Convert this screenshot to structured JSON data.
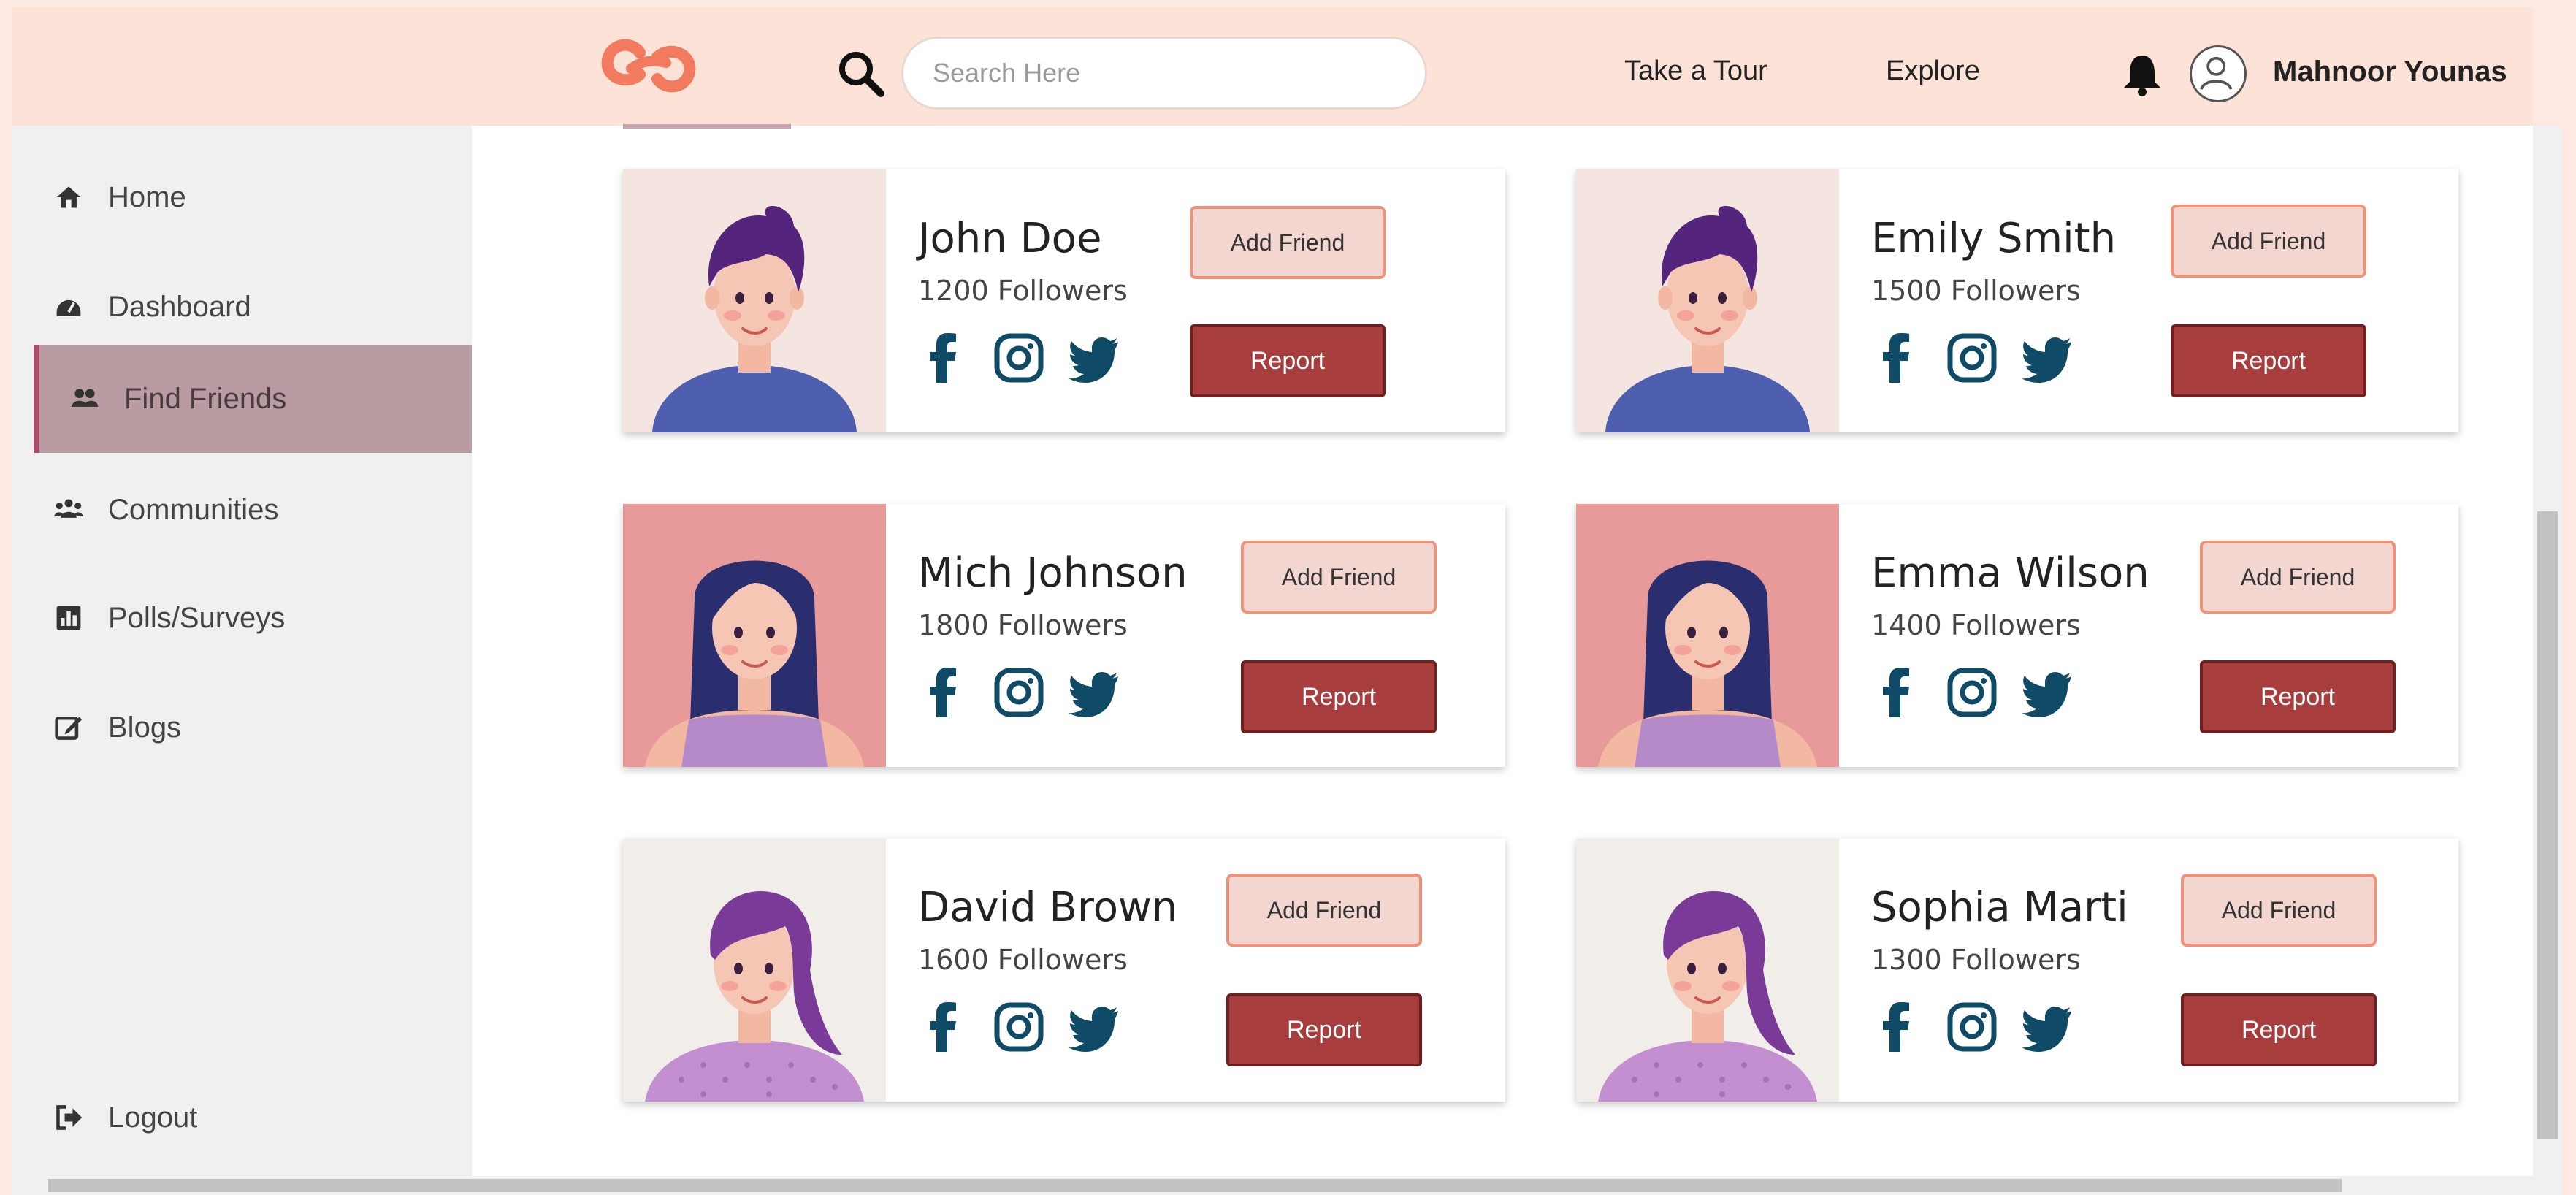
{
  "header": {
    "search_placeholder": "Search Here",
    "nav": {
      "tour": "Take a Tour",
      "explore": "Explore"
    },
    "user_name": "Mahnoor Younas"
  },
  "sidebar": {
    "items": [
      {
        "label": "Home",
        "icon": "home-icon"
      },
      {
        "label": "Dashboard",
        "icon": "dashboard-icon"
      },
      {
        "label": "Find Friends",
        "icon": "friends-icon",
        "active": true
      },
      {
        "label": "Communities",
        "icon": "communities-icon"
      },
      {
        "label": "Polls/Surveys",
        "icon": "polls-icon"
      },
      {
        "label": "Blogs",
        "icon": "blogs-icon"
      }
    ],
    "logout": "Logout"
  },
  "cards": [
    {
      "name": "John Doe",
      "followers": "1200 Followers",
      "add": "Add Friend",
      "report": "Report"
    },
    {
      "name": "Emily Smith",
      "followers": "1500 Followers",
      "add": "Add Friend",
      "report": "Report"
    },
    {
      "name": "Mich Johnson",
      "followers": "1800 Followers",
      "add": "Add Friend",
      "report": "Report"
    },
    {
      "name": "Emma Wilson",
      "followers": "1400 Followers",
      "add": "Add Friend",
      "report": "Report"
    },
    {
      "name": "David Brown",
      "followers": "1600 Followers",
      "add": "Add Friend",
      "report": "Report"
    },
    {
      "name": "Sophia Marti",
      "followers": "1300 Followers",
      "add": "Add Friend",
      "report": "Report"
    }
  ],
  "colors": {
    "header_bg": "#fde3d7",
    "accent": "#f0927a",
    "report": "#a73d3d",
    "social": "#0f4a66"
  }
}
